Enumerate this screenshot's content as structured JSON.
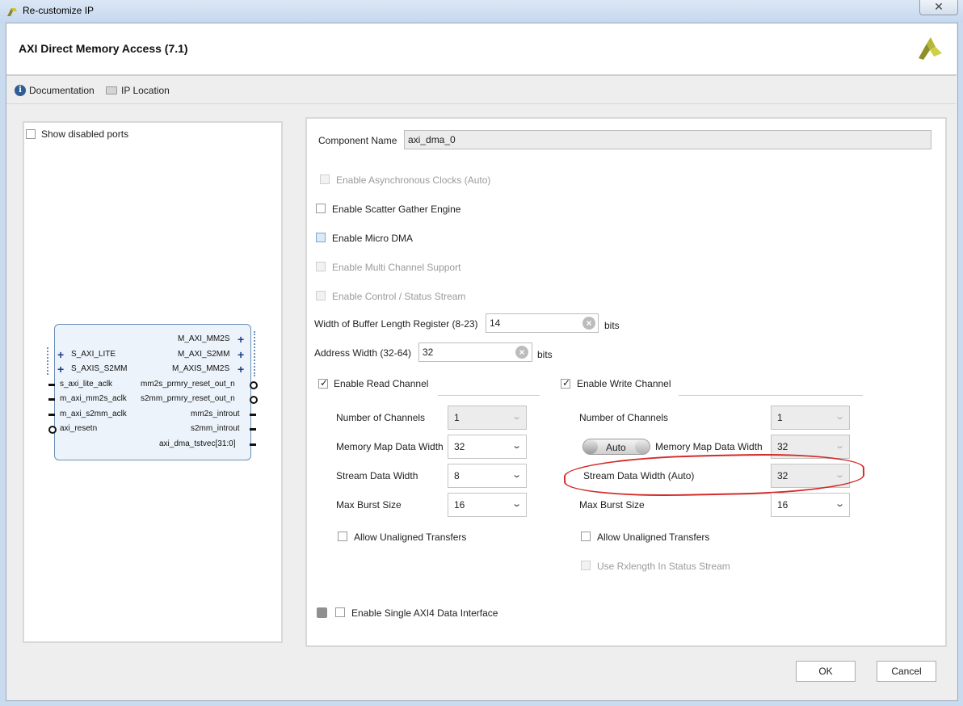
{
  "window": {
    "title": "Re-customize IP",
    "close_glyph": "✕"
  },
  "header": {
    "ip_title": "AXI Direct Memory Access (7.1)",
    "logo_icon": "xilinx-logo-icon"
  },
  "toolbar": {
    "documentation": "Documentation",
    "ip_location": "IP Location"
  },
  "left_panel": {
    "show_disabled_ports": "Show disabled ports",
    "block": {
      "left_ports": [
        "S_AXI_LITE",
        "S_AXIS_S2MM",
        "s_axi_lite_aclk",
        "m_axi_mm2s_aclk",
        "m_axi_s2mm_aclk",
        "axi_resetn"
      ],
      "right_ports": [
        "M_AXI_MM2S",
        "M_AXI_S2MM",
        "M_AXIS_MM2S",
        "mm2s_prmry_reset_out_n",
        "s2mm_prmry_reset_out_n",
        "mm2s_introut",
        "s2mm_introut",
        "axi_dma_tstvec[31:0]"
      ]
    }
  },
  "form": {
    "component_name_label": "Component Name",
    "component_name_value": "axi_dma_0",
    "enable_async_clocks": "Enable Asynchronous Clocks (Auto)",
    "enable_scatter_gather": "Enable Scatter Gather Engine",
    "enable_micro_dma": "Enable Micro DMA",
    "enable_multi_channel": "Enable Multi Channel Support",
    "enable_control_status": "Enable Control / Status Stream",
    "buffer_length_label": "Width of Buffer Length Register (8-23)",
    "buffer_length_value": "14",
    "buffer_length_unit": "bits",
    "address_width_label": "Address Width (32-64)",
    "address_width_value": "32",
    "address_width_unit": "bits",
    "read_channel": {
      "label": "Enable Read Channel",
      "num_channels_label": "Number of Channels",
      "num_channels_value": "1",
      "mm_data_width_label": "Memory Map Data Width",
      "mm_data_width_value": "32",
      "stream_data_width_label": "Stream Data Width",
      "stream_data_width_value": "8",
      "max_burst_label": "Max Burst Size",
      "max_burst_value": "16",
      "allow_unaligned": "Allow Unaligned Transfers"
    },
    "write_channel": {
      "label": "Enable Write Channel",
      "num_channels_label": "Number of Channels",
      "num_channels_value": "1",
      "auto_toggle": "Auto",
      "mm_data_width_label": "Memory Map Data Width",
      "mm_data_width_value": "32",
      "stream_data_width_label": "Stream Data Width (Auto)",
      "stream_data_width_value": "32",
      "max_burst_label": "Max Burst Size",
      "max_burst_value": "16",
      "allow_unaligned": "Allow Unaligned Transfers",
      "use_rxlength": "Use Rxlength In Status Stream"
    },
    "enable_single_axi4": "Enable Single AXI4 Data Interface"
  },
  "buttons": {
    "ok": "OK",
    "cancel": "Cancel"
  },
  "colors": {
    "annotation_red": "#d42a2a",
    "block_border": "#6b8fb8",
    "block_fill": "#edf3fa"
  }
}
